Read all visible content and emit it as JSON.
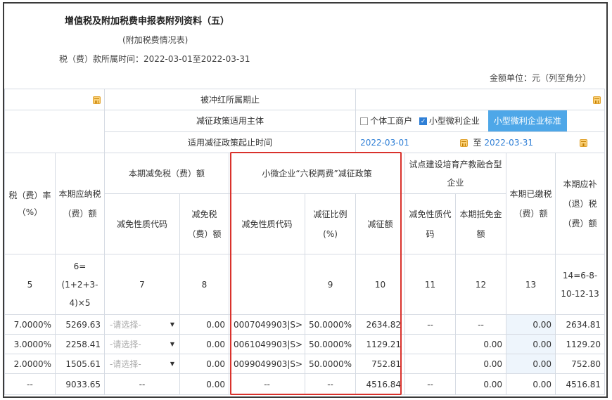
{
  "header": {
    "title": "增值税及附加税费申报表附列资料（五）",
    "subtitle": "(附加税费情况表)",
    "period_label": "税（费）款所属时间：2022-03-01至2022-03-31",
    "unit": "金额单位：元（列至角分）"
  },
  "rows_top": {
    "hongchong_label": "被冲红所属期止",
    "policy_subject_label": "减征政策适用主体",
    "option_individual": "个体工商户",
    "option_small": "小型微利企业",
    "standard_button": "小型微利企业标准",
    "policy_period_label": "适用减征政策起止时间",
    "start_date": "2022-03-01",
    "to_label": "至",
    "end_date": "2022-03-31"
  },
  "columns": {
    "rate": "税（费）率（%）",
    "payable": "本期应纳税（费）额",
    "reduce_group": "本期减免税（费）额",
    "reduce_code": "减免性质代码",
    "reduce_amount": "减免税（费）额",
    "small_group": "小微企业“六税两费”减征政策",
    "small_code": "减免性质代码",
    "small_ratio": "减征比例(%)",
    "small_amount": "减征额",
    "pilot_group": "试点建设培育产教融合型企业",
    "pilot_code": "减免性质代码",
    "pilot_deduct": "本期抵免金额",
    "paid": "本期已缴税（费）额",
    "refund": "本期应补（退）税（费）额"
  },
  "col_numbers": [
    "5",
    "6=(1+2+3-4)×5",
    "7",
    "8",
    "",
    "9",
    "10",
    "11",
    "12",
    "13",
    "14=6-8-10-12-13"
  ],
  "select_placeholder": "-请选择-",
  "rows": [
    {
      "rate": "7.0000%",
      "payable": "5269.63",
      "reduce_amount": "0.00",
      "small_code": "0007049903|S>",
      "small_ratio": "50.0000%",
      "small_amount": "2634.82",
      "pilot_code": "--",
      "pilot_deduct": "--",
      "paid": "0.00",
      "refund": "2634.81"
    },
    {
      "rate": "3.0000%",
      "payable": "2258.41",
      "reduce_amount": "0.00",
      "small_code": "0061049903|S>",
      "small_ratio": "50.0000%",
      "small_amount": "1129.21",
      "pilot_code": "",
      "pilot_deduct": "0.00",
      "paid": "0.00",
      "refund": "1129.20"
    },
    {
      "rate": "2.0000%",
      "payable": "1505.61",
      "reduce_amount": "0.00",
      "small_code": "0099049903|S>",
      "small_ratio": "50.0000%",
      "small_amount": "752.81",
      "pilot_code": "",
      "pilot_deduct": "0.00",
      "paid": "0.00",
      "refund": "752.80"
    }
  ],
  "total_row": {
    "rate": "--",
    "payable": "9033.65",
    "reduce_code": "--",
    "reduce_amount": "0.00",
    "small_code": "--",
    "small_ratio": "--",
    "small_amount": "4516.84",
    "pilot_code": "--",
    "pilot_deduct": "0.00",
    "paid": "0.00",
    "refund": "4516.81"
  },
  "colors": {
    "accent": "#2f7fd6",
    "highlight": "#d9322c",
    "button": "#4ea7e8"
  }
}
